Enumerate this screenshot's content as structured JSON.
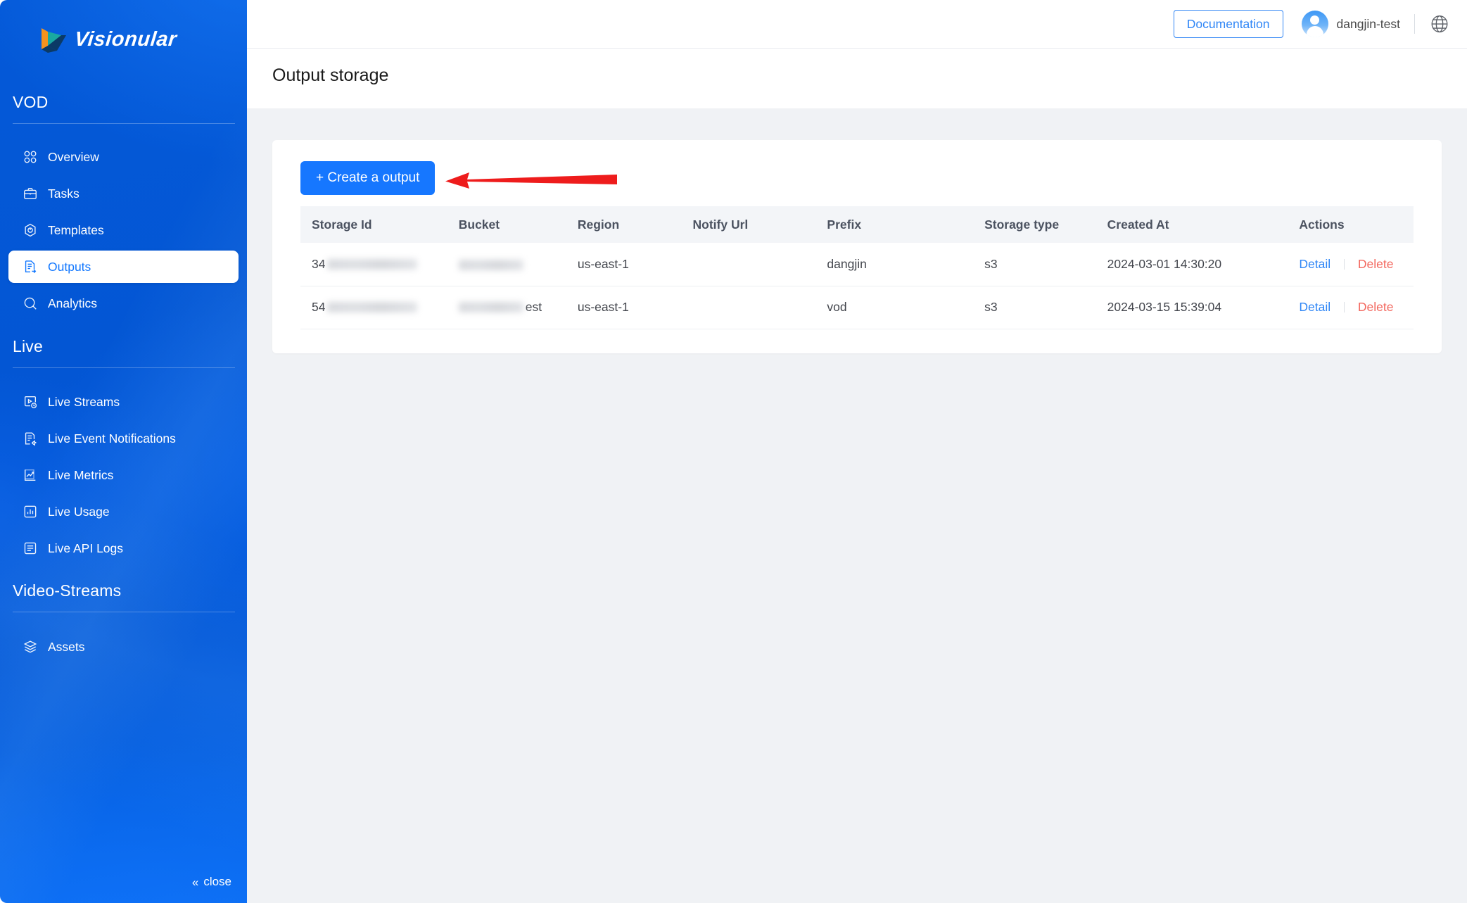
{
  "brand": {
    "name": "Visionular",
    "logo_icon": "visionular-logo-icon"
  },
  "sidebar": {
    "groups": [
      {
        "title": "VOD",
        "items": [
          {
            "label": "Overview",
            "icon": "grid-icon",
            "active": false
          },
          {
            "label": "Tasks",
            "icon": "briefcase-icon",
            "active": false
          },
          {
            "label": "Templates",
            "icon": "hexagon-icon",
            "active": false
          },
          {
            "label": "Outputs",
            "icon": "document-export-icon",
            "active": true
          },
          {
            "label": "Analytics",
            "icon": "search-circle-icon",
            "active": false
          }
        ]
      },
      {
        "title": "Live",
        "items": [
          {
            "label": "Live Streams",
            "icon": "stream-clock-icon",
            "active": false
          },
          {
            "label": "Live Event Notifications",
            "icon": "notification-document-icon",
            "active": false
          },
          {
            "label": "Live Metrics",
            "icon": "line-chart-icon",
            "active": false
          },
          {
            "label": "Live Usage",
            "icon": "bar-chart-icon",
            "active": false
          },
          {
            "label": "Live API Logs",
            "icon": "logs-icon",
            "active": false
          }
        ]
      },
      {
        "title": "Video-Streams",
        "items": [
          {
            "label": "Assets",
            "icon": "layers-icon",
            "active": false
          }
        ]
      }
    ],
    "close_label": "close",
    "close_icon": "double-chevron-left-icon"
  },
  "topbar": {
    "documentation_label": "Documentation",
    "username": "dangjin-test",
    "avatar_icon": "user-avatar-icon",
    "globe_icon": "globe-icon"
  },
  "page": {
    "title": "Output storage"
  },
  "toolbar": {
    "create_label": "+ Create a output",
    "annotation_arrow_color": "#ee1c1c"
  },
  "table": {
    "columns": [
      "Storage Id",
      "Bucket",
      "Region",
      "Notify Url",
      "Prefix",
      "Storage type",
      "Created At",
      "Actions"
    ],
    "rows": [
      {
        "storage_id_prefix": "34",
        "storage_id_redacted": true,
        "bucket_prefix": "",
        "bucket_suffix": "",
        "bucket_redacted": true,
        "region": "us-east-1",
        "notify_url": "",
        "prefix": "dangjin",
        "storage_type": "s3",
        "created_at": "2024-03-01 14:30:20",
        "detail_label": "Detail",
        "delete_label": "Delete"
      },
      {
        "storage_id_prefix": "54",
        "storage_id_redacted": true,
        "bucket_prefix": "",
        "bucket_suffix": "est",
        "bucket_redacted": true,
        "region": "us-east-1",
        "notify_url": "",
        "prefix": "vod",
        "storage_type": "s3",
        "created_at": "2024-03-15 15:39:04",
        "detail_label": "Detail",
        "delete_label": "Delete"
      }
    ]
  },
  "colors": {
    "sidebar_blue": "#0356d4",
    "accent_blue": "#1677ff",
    "link_blue": "#2f86f6",
    "danger_red": "#f3685f",
    "content_bg": "#f0f2f5",
    "annotation_red": "#ee1c1c"
  }
}
